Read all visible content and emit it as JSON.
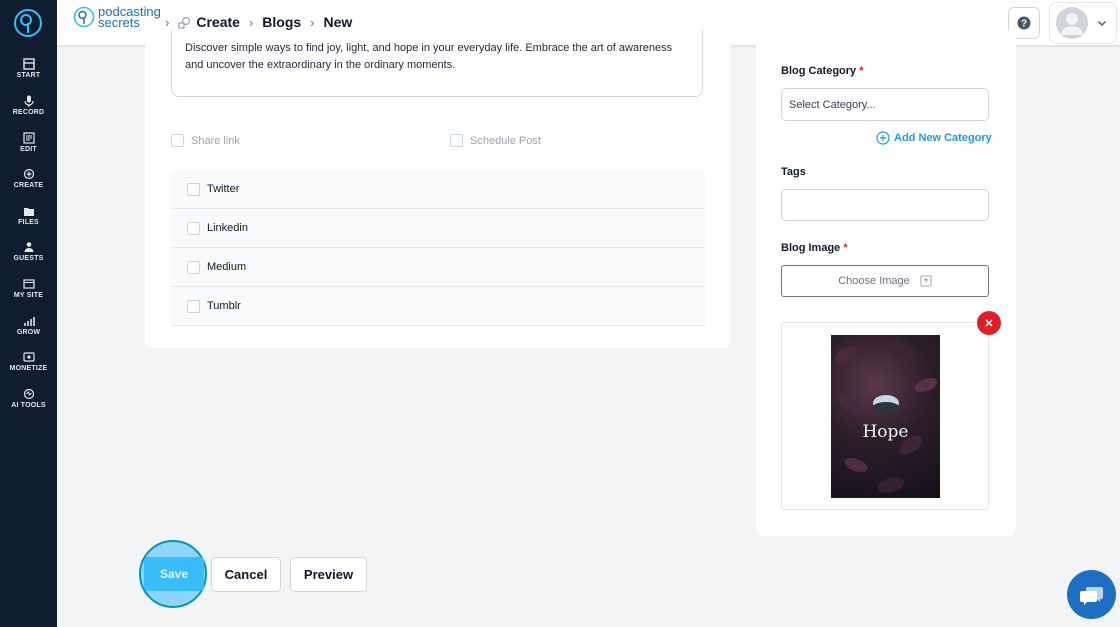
{
  "sidebar": {
    "items": [
      {
        "label": "START",
        "icon": "start-icon"
      },
      {
        "label": "RECORD",
        "icon": "microphone-icon"
      },
      {
        "label": "EDIT",
        "icon": "edit-icon"
      },
      {
        "label": "CREATE",
        "icon": "create-icon"
      },
      {
        "label": "FILES",
        "icon": "files-icon"
      },
      {
        "label": "GUESTS",
        "icon": "guests-icon"
      },
      {
        "label": "MY SITE",
        "icon": "site-icon"
      },
      {
        "label": "GROW",
        "icon": "grow-icon"
      },
      {
        "label": "MONETIZE",
        "icon": "monetize-icon"
      },
      {
        "label": "AI TOOLS",
        "icon": "ai-tools-icon"
      }
    ]
  },
  "header": {
    "brand_line1": "podcasting",
    "brand_line2": "secrets",
    "breadcrumb": [
      "Create",
      "Blogs",
      "New"
    ]
  },
  "form": {
    "description": "Discover simple ways to find joy, light, and hope in your everyday life. Embrace the art of awareness and uncover the extraordinary in the ordinary moments.",
    "share_link_label": "Share link",
    "schedule_post_label": "Schedule Post",
    "social": [
      "Twitter",
      "Linkedin",
      "Medium",
      "Tumblr"
    ],
    "category_label": "Blog Category",
    "category_placeholder": "Select Category...",
    "add_category_label": "Add New Category",
    "tags_label": "Tags",
    "image_label": "Blog Image",
    "choose_image_label": "Choose Image",
    "image_caption": "Hope",
    "required_mark": "*"
  },
  "actions": {
    "save": "Save",
    "cancel": "Cancel",
    "preview": "Preview"
  },
  "colors": {
    "sidebar_bg": "#0f1e2e",
    "accent": "#38bdf8",
    "link": "#1d9bd7",
    "danger": "#e11d2a",
    "chat": "#1e6fc1"
  }
}
